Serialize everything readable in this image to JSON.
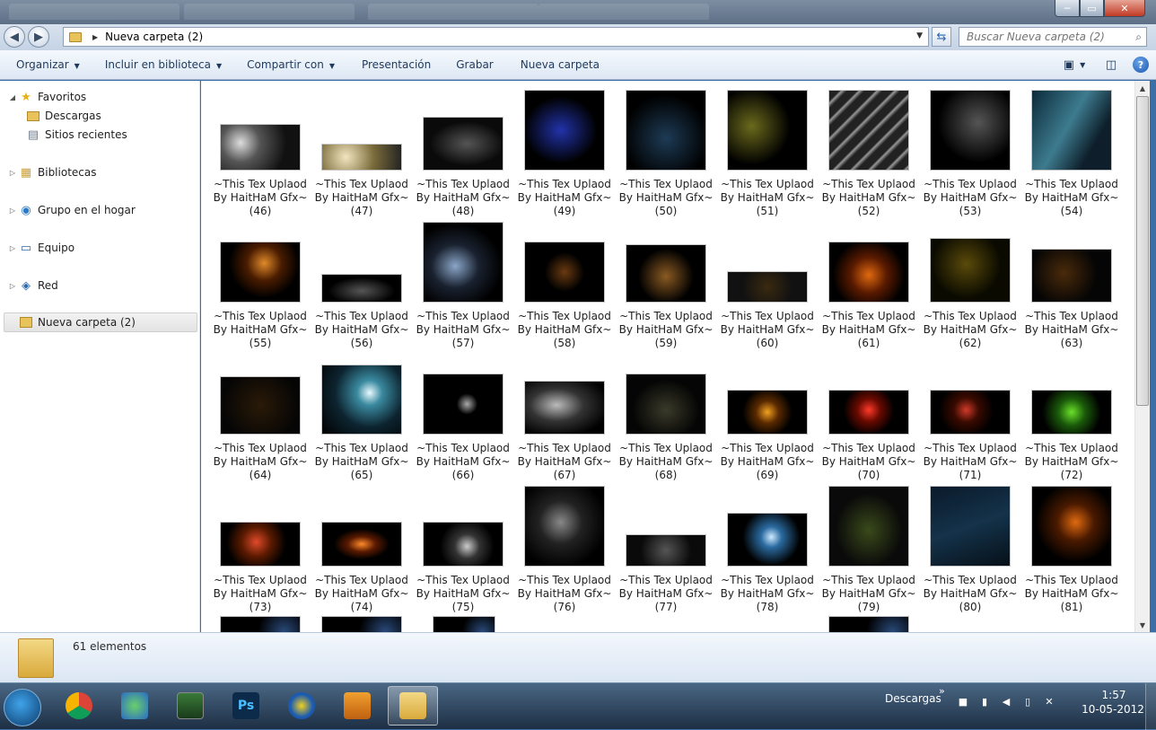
{
  "window": {
    "title_tabs": [
      "",
      "",
      "",
      ""
    ],
    "controls": {
      "minimize": "─",
      "maximize": "▭",
      "close": "✕"
    }
  },
  "address": {
    "path": "Nueva carpeta (2)",
    "search_placeholder": "Buscar Nueva carpeta (2)"
  },
  "toolbar": {
    "organize": "Organizar",
    "include": "Incluir en biblioteca",
    "share": "Compartir con",
    "slideshow": "Presentación",
    "burn": "Grabar",
    "new_folder": "Nueva carpeta",
    "help": "?"
  },
  "nav": {
    "favorites": "Favoritos",
    "downloads": "Descargas",
    "recent": "Sitios recientes",
    "libraries": "Bibliotecas",
    "homegroup": "Grupo en el hogar",
    "computer": "Equipo",
    "network": "Red",
    "current": "Nueva carpeta (2)"
  },
  "files": {
    "line1": "~This Tex Uplaod",
    "line2": "By HaitHaM Gfx~",
    "items": [
      {
        "n": "(46)",
        "bg": "radial-gradient(circle at 25% 40%,#ddd,#555 30%,#111 70%)"
      },
      {
        "n": "(47)",
        "bg": "radial-gradient(circle at 30% 50%,#f2e6c0,#7a6b3a 50%,#222)"
      },
      {
        "n": "(48)",
        "bg": "radial-gradient(ellipse at 55% 50%,#555,#0a0a0a 60%)"
      },
      {
        "n": "(49)",
        "bg": "radial-gradient(ellipse at 45% 50%,#2233aa,#000 60%)"
      },
      {
        "n": "(50)",
        "bg": "radial-gradient(circle at 50% 60%,#1d3b55,#000 70%)"
      },
      {
        "n": "(51)",
        "bg": "radial-gradient(circle at 30% 45%,#6b6a1c,#000 55%)"
      },
      {
        "n": "(52)",
        "bg": "repeating-linear-gradient(135deg,#222 0 8px,#999 10px,#222 14px)"
      },
      {
        "n": "(53)",
        "bg": "radial-gradient(ellipse at 60% 40%,#555,#000 60%)"
      },
      {
        "n": "(54)",
        "bg": "linear-gradient(120deg,#0b2a3a,#3d7b8e 45%,#0e1f2b 75%)"
      },
      {
        "n": "(55)",
        "bg": "radial-gradient(circle at 55% 35%,#e08a2a,#4a1c00 30%,#000 60%)"
      },
      {
        "n": "(56)",
        "bg": "radial-gradient(ellipse at 50% 60%,#555,#000 60%)"
      },
      {
        "n": "(57)",
        "bg": "radial-gradient(ellipse at 40% 55%,#8aa6c8,#1a2230 35%,#000 70%)"
      },
      {
        "n": "(58)",
        "bg": "radial-gradient(circle at 50% 50%,#6a3a10,#000 40%)"
      },
      {
        "n": "(59)",
        "bg": "radial-gradient(circle at 50% 55%,#8a5a22,#000 55%)"
      },
      {
        "n": "(60)",
        "bg": "radial-gradient(circle at 50% 50%,#3a2a10,#111 60%)"
      },
      {
        "n": "(61)",
        "bg": "radial-gradient(circle at 50% 55%,#e06a10,#5a1a00 35%,#000 70%)"
      },
      {
        "n": "(62)",
        "bg": "radial-gradient(circle at 45% 40%,#5a4a0a,#0a0a00 60%)"
      },
      {
        "n": "(63)",
        "bg": "radial-gradient(circle at 40% 45%,#4a2a0a,#050505 60%)"
      },
      {
        "n": "(64)",
        "bg": "radial-gradient(circle at 50% 50%,#2a1a08,#050505 80%)"
      },
      {
        "n": "(65)",
        "bg": "radial-gradient(circle at 60% 40%,#eafaff,#3a8aa0 20%,#0d2430 55%,#000)"
      },
      {
        "n": "(66)",
        "bg": "radial-gradient(circle at 55% 50%,#aaa,#000 20%)"
      },
      {
        "n": "(67)",
        "bg": "radial-gradient(ellipse at 40% 45%,#bbb,#333 40%,#000 80%)"
      },
      {
        "n": "(68)",
        "bg": "radial-gradient(ellipse at 50% 60%,#3a3a2a,#050505 60%)"
      },
      {
        "n": "(69)",
        "bg": "radial-gradient(circle at 50% 50%,#f2a020,#5a2a00 25%,#000 55%)"
      },
      {
        "n": "(70)",
        "bg": "radial-gradient(circle at 50% 45%,#ff3a2a,#6a0a00 25%,#000 55%)"
      },
      {
        "n": "(71)",
        "bg": "radial-gradient(circle at 45% 45%,#d03a2a,#3a0a00 25%,#000 55%)"
      },
      {
        "n": "(72)",
        "bg": "radial-gradient(circle at 50% 50%,#6ae02a,#1a5a0a 30%,#000 65%)"
      },
      {
        "n": "(73)",
        "bg": "radial-gradient(circle at 45% 45%,#e04a2a,#5a1a00 30%,#000 60%)"
      },
      {
        "n": "(74)",
        "bg": "radial-gradient(ellipse at 50% 50%,#ff8a2a,#5a1a00 25%,#000 50%)"
      },
      {
        "n": "(75)",
        "bg": "radial-gradient(circle at 55% 55%,#ccc,#333 25%,#000 55%)"
      },
      {
        "n": "(76)",
        "bg": "radial-gradient(ellipse at 45% 45%,#888,#222 35%,#000 75%)"
      },
      {
        "n": "(77)",
        "bg": "radial-gradient(circle at 50% 50%,#555,#0a0a0a 60%)"
      },
      {
        "n": "(78)",
        "bg": "radial-gradient(circle at 55% 45%,#cfeaff,#2a6aa0 20%,#000 55%)"
      },
      {
        "n": "(79)",
        "bg": "radial-gradient(ellipse at 50% 55%,#3a4a1a,#0a0a0a 60%)"
      },
      {
        "n": "(80)",
        "bg": "linear-gradient(160deg,#0a1a2a,#14324a 50%,#061018)"
      },
      {
        "n": "(81)",
        "bg": "radial-gradient(circle at 55% 45%,#e06a10,#4a1a00 30%,#000 65%)"
      }
    ]
  },
  "status": {
    "count": "61 elementos"
  },
  "taskbar": {
    "tray_label": "Descargas",
    "tray_chevron": "»",
    "time": "1:57",
    "date": "10-05-2012",
    "ps_label": "Ps"
  },
  "colors": {
    "accent": "#1e395b",
    "selection": "#e3e3e3",
    "taskbar": "#1d2f44"
  }
}
